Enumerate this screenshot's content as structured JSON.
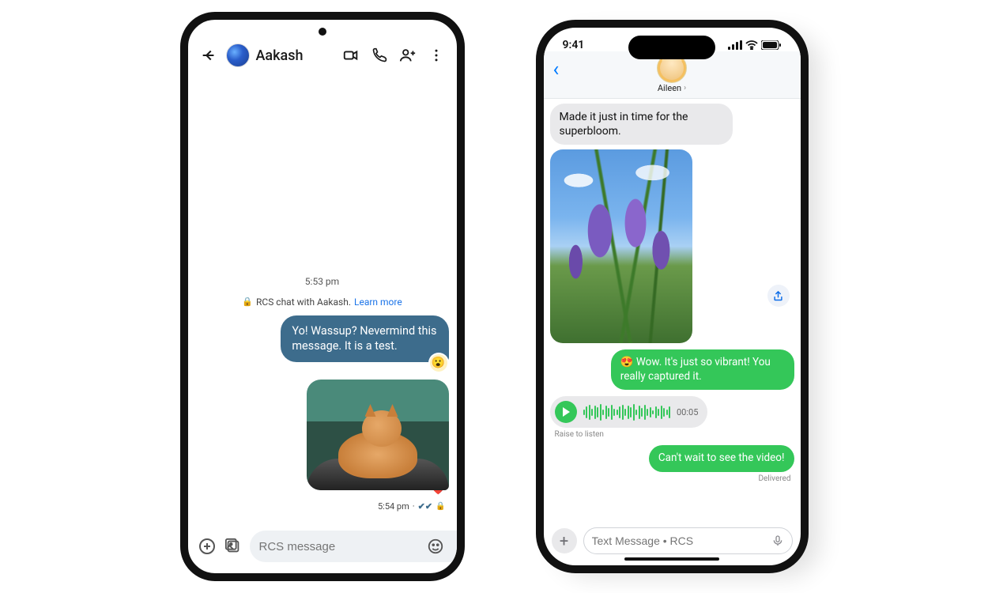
{
  "android": {
    "contact_name": "Aakash",
    "timestamp_header": "5:53 pm",
    "rcs_line": "RCS chat with Aakash.",
    "learn_more": "Learn more",
    "sent_msg": "Yo! Wassup? Nevermind this message. It is a test.",
    "sent_reaction": "😮",
    "image_reaction": "❤️",
    "image_meta_time": "5:54 pm",
    "composer_placeholder": "RCS message"
  },
  "iphone": {
    "status_time": "9:41",
    "contact_name": "Aileen",
    "recv_msg": "Made it just in time for the superbloom.",
    "green_msg_1": "😍 Wow. It's just so vibrant! You really captured it.",
    "voice_duration": "00:05",
    "raise_hint": "Raise to listen",
    "green_msg_2": "Can't wait to see the video!",
    "delivered": "Delivered",
    "composer_placeholder": "Text Message • RCS"
  }
}
